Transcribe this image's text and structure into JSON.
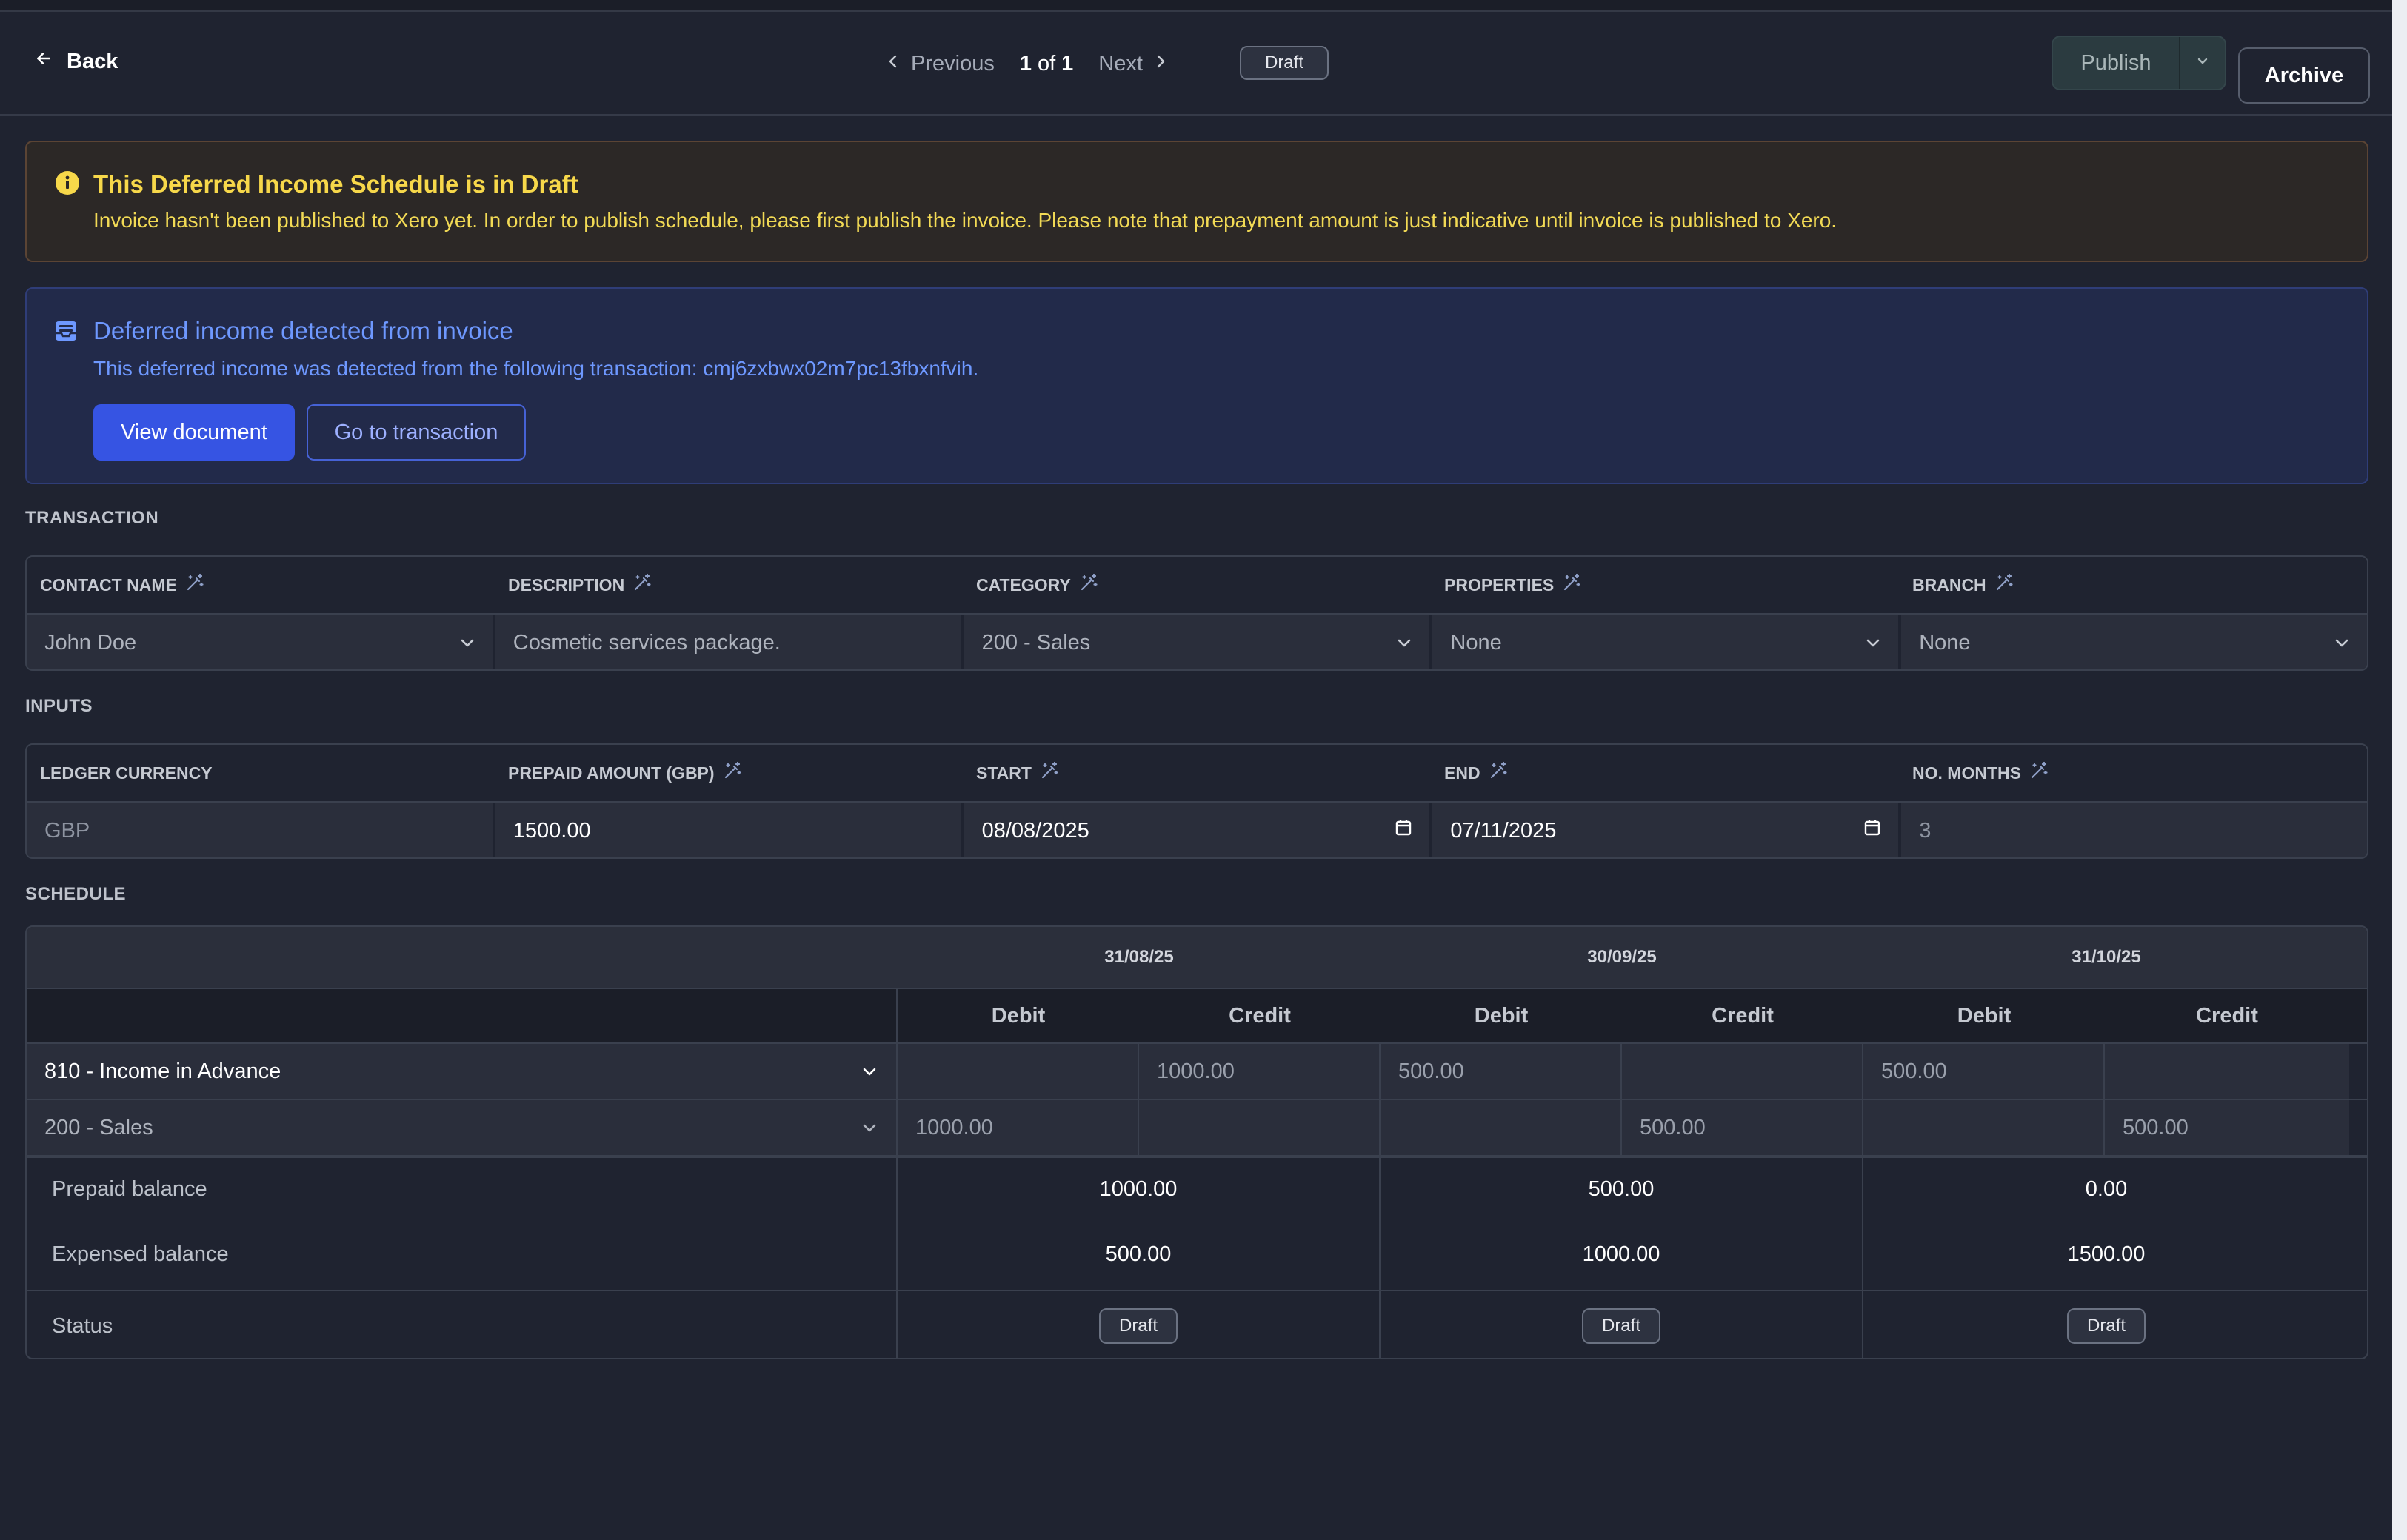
{
  "toolbar": {
    "back_label": "Back",
    "previous_label": "Previous",
    "page_current": "1",
    "page_of": "of",
    "page_total": "1",
    "next_label": "Next",
    "status_badge": "Draft",
    "publish_label": "Publish",
    "archive_label": "Archive"
  },
  "warning": {
    "title": "This Deferred Income Schedule is in Draft",
    "text": "Invoice hasn't been published to Xero yet. In order to publish schedule, please first publish the invoice. Please note that prepayment amount is just indicative until invoice is published to Xero.",
    "icon": "info-circle-icon",
    "color": "#f7d84a"
  },
  "info": {
    "title": "Deferred income detected from invoice",
    "text": "This deferred income was detected from the following transaction: cmj6zxbwx02m7pc13fbxnfvih.",
    "view_document_label": "View document",
    "go_to_transaction_label": "Go to transaction",
    "icon": "inbox-icon",
    "color": "#6e98ff"
  },
  "transaction": {
    "section_label": "TRANSACTION",
    "headers": [
      "CONTACT NAME",
      "DESCRIPTION",
      "CATEGORY",
      "PROPERTIES",
      "BRANCH"
    ],
    "contact_name": "John Doe",
    "description": "Cosmetic services package.",
    "category": "200 - Sales",
    "properties": "None",
    "branch": "None"
  },
  "inputs": {
    "section_label": "INPUTS",
    "headers": [
      "LEDGER CURRENCY",
      "PREPAID AMOUNT (GBP)",
      "START",
      "END",
      "NO. MONTHS"
    ],
    "ledger_currency": "GBP",
    "prepaid_amount": "1500.00",
    "start": "08/08/2025",
    "end": "07/11/2025",
    "no_months": "3"
  },
  "schedule": {
    "section_label": "SCHEDULE",
    "dates": [
      "31/08/25",
      "30/09/25",
      "31/10/25"
    ],
    "debit_label": "Debit",
    "credit_label": "Credit",
    "rows": [
      {
        "account": "810 - Income in Advance",
        "cells": [
          "",
          "1000.00",
          "500.00",
          "",
          "500.00",
          ""
        ]
      },
      {
        "account": "200 - Sales",
        "cells": [
          "1000.00",
          "",
          "",
          "500.00",
          "",
          "500.00"
        ]
      }
    ],
    "prepaid_balance_label": "Prepaid balance",
    "prepaid_balance": [
      "1000.00",
      "500.00",
      "0.00"
    ],
    "expensed_balance_label": "Expensed balance",
    "expensed_balance": [
      "500.00",
      "1000.00",
      "1500.00"
    ],
    "status_label": "Status",
    "status": [
      "Draft",
      "Draft",
      "Draft"
    ]
  }
}
